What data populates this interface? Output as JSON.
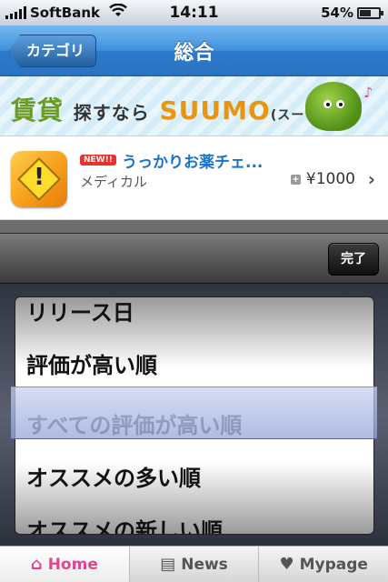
{
  "status_bar": {
    "carrier": "SoftBank",
    "time": "14:11",
    "battery": "54%"
  },
  "nav": {
    "back_label": "カテゴリ",
    "title": "総合"
  },
  "ad": {
    "kanji": "賃貸",
    "middle": "探すなら",
    "brand": "SUUMO",
    "paren": "(スーモ)"
  },
  "app": {
    "badge": "NEW!!",
    "name": "うっかりお薬チェ...",
    "category": "メディカル",
    "price": "¥1000"
  },
  "picker": {
    "done_label": "完了",
    "options": [
      "リリース日",
      "評価が高い順",
      "すべての評価が高い順",
      "オススメの多い順",
      "オススメの新しい順"
    ],
    "selected": "すべての評価が高い順"
  },
  "tabs": [
    {
      "label": "Home",
      "icon": "home-icon"
    },
    {
      "label": "News",
      "icon": "news-icon"
    },
    {
      "label": "Mypage",
      "icon": "heart-icon"
    }
  ],
  "colors": {
    "accent": "#e2468f",
    "nav_blue": "#3f8fdb",
    "link_blue": "#1a73c9"
  }
}
